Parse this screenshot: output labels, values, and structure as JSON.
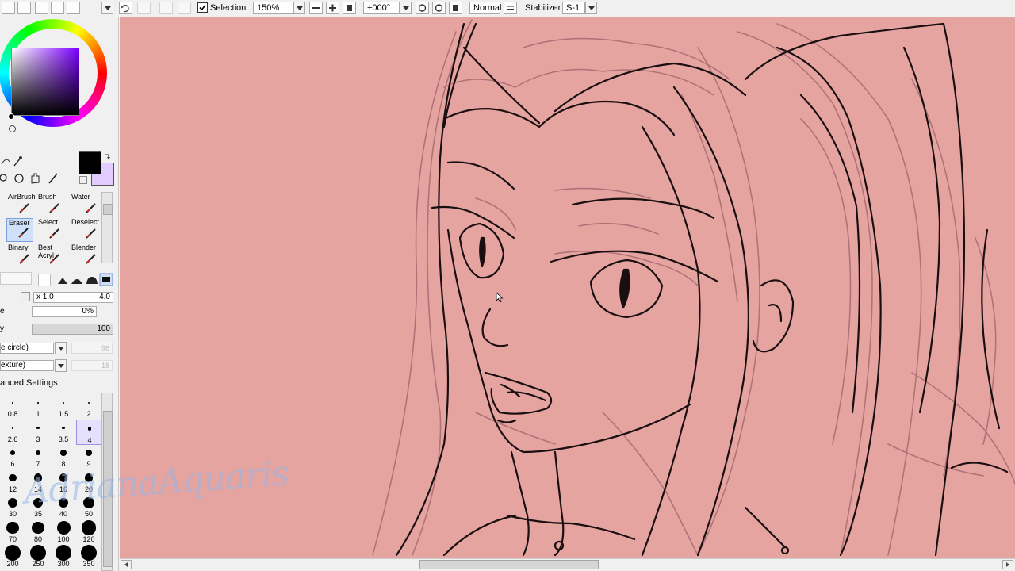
{
  "toolbar": {
    "selection_label": "Selection",
    "selection_checked": true,
    "zoom": "150%",
    "rotation": "+000°",
    "blend_mode": "Normal",
    "stabilizer_label": "Stabilizer",
    "stabilizer_value": "S-1"
  },
  "colors": {
    "canvas_bg": "#e6a4a1",
    "line_dark": "#1a0f10",
    "sketch_line": "#a66a70",
    "primary_color": "#000000",
    "secondary_color": "#e2ccff",
    "accent_hue": "#7b00ff"
  },
  "tools": [
    {
      "label": "AirBrush",
      "icon": "airbrush-icon",
      "selected": false
    },
    {
      "label": "Brush",
      "icon": "brush-icon",
      "selected": false
    },
    {
      "label": "Water",
      "icon": "water-brush-icon",
      "selected": false
    },
    {
      "label": "Eraser",
      "icon": "eraser-icon",
      "selected": true
    },
    {
      "label": "Select",
      "icon": "select-icon",
      "selected": false
    },
    {
      "label": "Deselect",
      "icon": "deselect-icon",
      "selected": false
    },
    {
      "label": "Binary",
      "icon": "binary-icon",
      "selected": false
    },
    {
      "label": "Best\nAcryl",
      "icon": "acrylic-icon",
      "selected": false
    },
    {
      "label": "Blender",
      "icon": "blender-icon",
      "selected": false
    }
  ],
  "brush_settings": {
    "size_multiplier": "x 1.0",
    "size_value": "4.0",
    "min_size_value": "0%",
    "density_value": "100",
    "shape_label": "e circle)",
    "shape_value": "96",
    "texture_label": "exture)",
    "texture_value": "18",
    "advanced_label": "anced Settings"
  },
  "brush_sizes": [
    "0.8",
    "1",
    "1.5",
    "2",
    "2.6",
    "3",
    "3.5",
    "4",
    "6",
    "7",
    "8",
    "9",
    "12",
    "14",
    "16",
    "20",
    "30",
    "35",
    "40",
    "50",
    "70",
    "80",
    "100",
    "120",
    "200",
    "250",
    "300",
    "350"
  ],
  "selected_brush_size": "4",
  "watermark": "AdrianaAquaris"
}
